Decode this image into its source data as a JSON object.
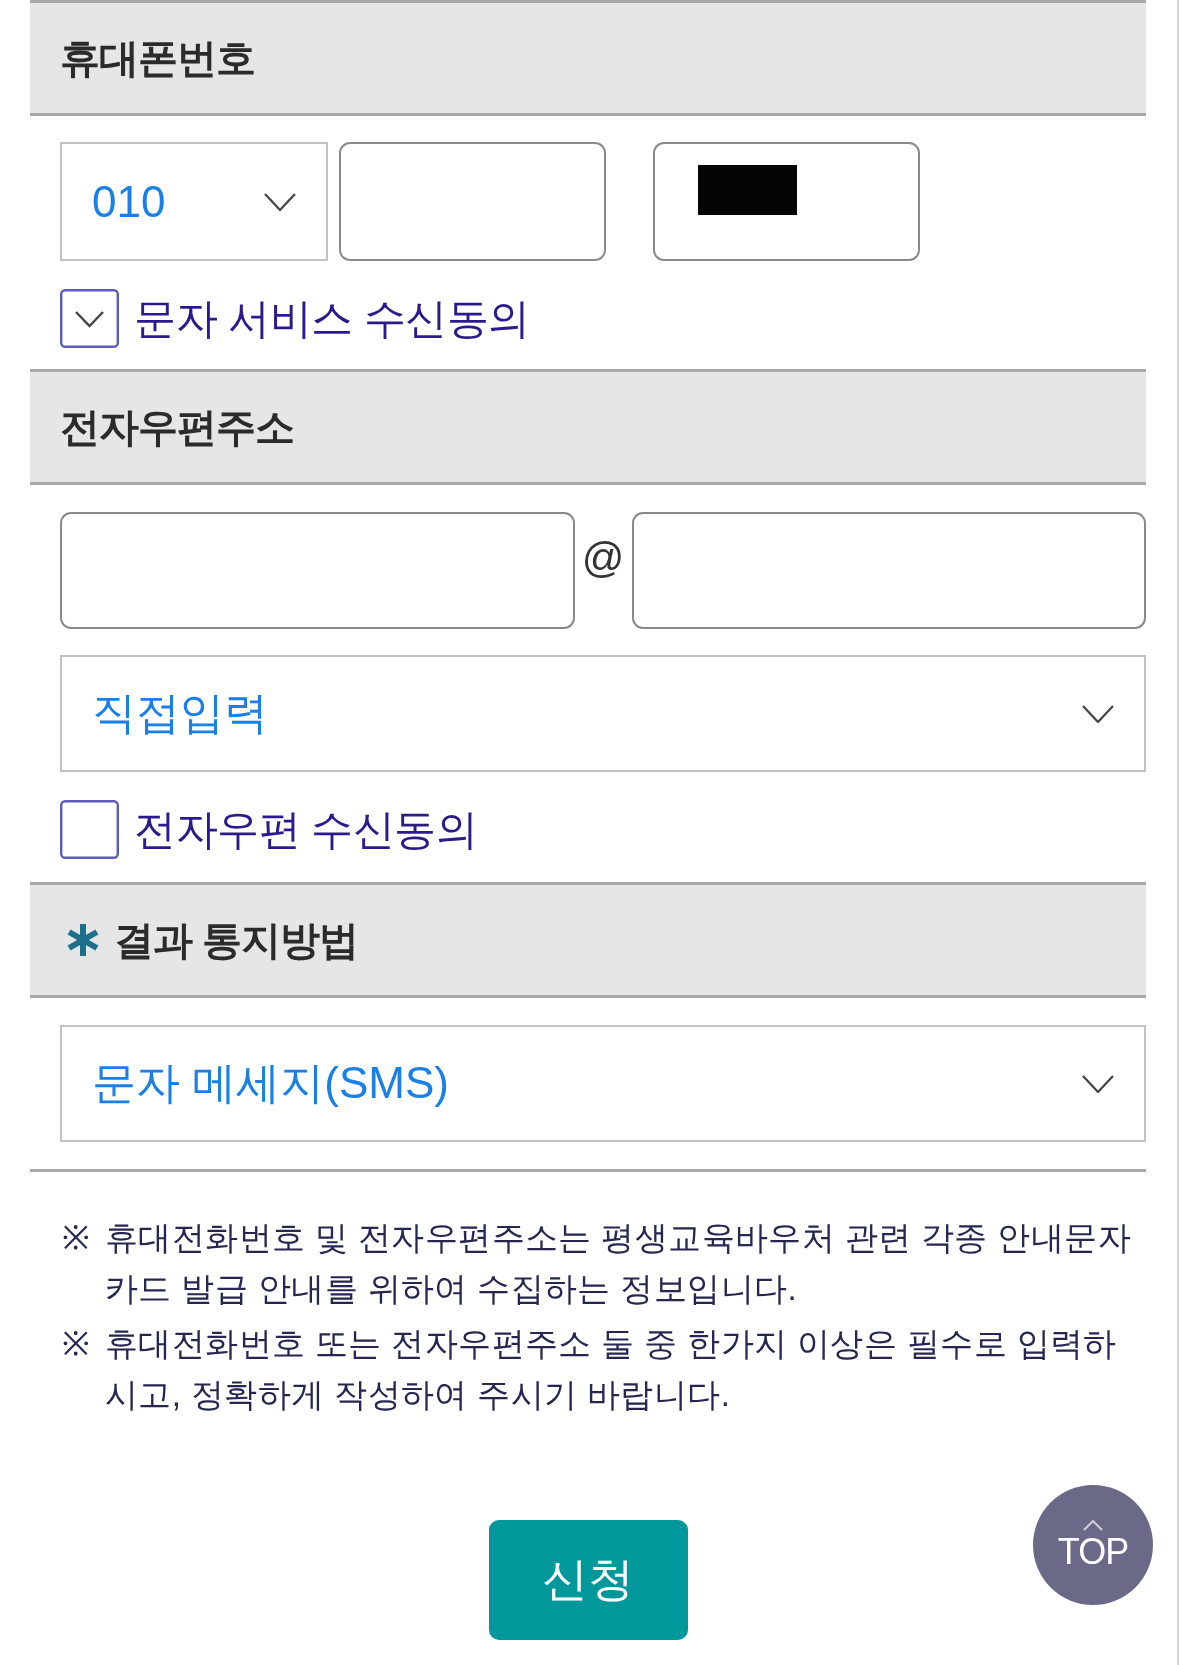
{
  "phone": {
    "heading": "휴대폰번호",
    "prefix": "010",
    "number_fields": [
      {
        "redacted": false
      },
      {
        "redacted": true
      }
    ],
    "consent": {
      "label": "문자 서비스 수신동의",
      "checked": true
    }
  },
  "email": {
    "heading": "전자우편주소",
    "at_sign": "@",
    "domain": "직접입력",
    "consent": {
      "label": "전자우편 수신동의",
      "checked": false
    }
  },
  "notification": {
    "heading": "결과 통지방법",
    "required": true,
    "method": "문자 메세지(SMS)"
  },
  "notes": [
    {
      "mark": "※",
      "text": "휴대전화번호 및 전자우편주소는 평생교육바우처 관련 각종 안내문자 카드 발급 안내를 위하여 수집하는 정보입니다."
    },
    {
      "mark": "※",
      "text": "휴대전화번호 또는 전자우편주소 둘 중 한가지 이상은 필수로 입력하시고, 정확하게 작성하여 주시기 바랍니다."
    }
  ],
  "submit_button": {
    "label": "신청"
  },
  "top_button": {
    "label": "TOP"
  }
}
